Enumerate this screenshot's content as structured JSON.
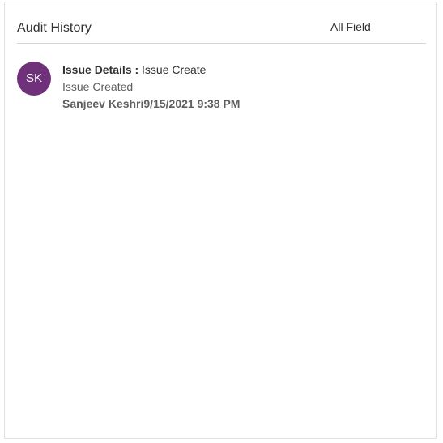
{
  "header": {
    "title": "Audit History",
    "filter_label": "All Field"
  },
  "entries": [
    {
      "avatar_initials": "SK",
      "field_label": "Issue Details :",
      "field_value": "Issue Create",
      "action": "Issue Created",
      "user": "Sanjeev Keshri",
      "timestamp": "9/15/2021 9:38 PM"
    }
  ],
  "colors": {
    "avatar": "#6f317a",
    "text": "#323130",
    "muted": "#605e5c",
    "divider": "#d6d6d6"
  }
}
